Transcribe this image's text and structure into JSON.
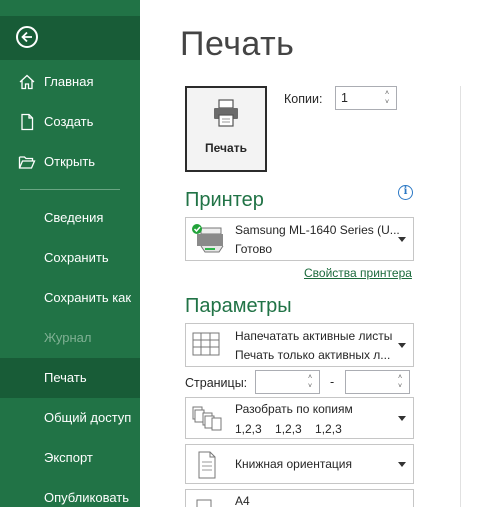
{
  "sidebar": {
    "back_icon": "back-arrow-icon",
    "items": [
      {
        "label": "Главная",
        "icon": "home-icon"
      },
      {
        "label": "Создать",
        "icon": "new-document-icon"
      },
      {
        "label": "Открыть",
        "icon": "open-folder-icon"
      },
      {
        "label": "Сведения"
      },
      {
        "label": "Сохранить"
      },
      {
        "label": "Сохранить как"
      },
      {
        "label": "Журнал",
        "disabled": true
      },
      {
        "label": "Печать",
        "selected": true
      },
      {
        "label": "Общий доступ"
      },
      {
        "label": "Экспорт"
      },
      {
        "label": "Опубликовать"
      }
    ]
  },
  "main": {
    "title": "Печать",
    "print_button_label": "Печать",
    "copies_label": "Копии:",
    "copies_value": "1",
    "printer_section": "Принтер",
    "printer": {
      "name": "Samsung ML-1640 Series (U...",
      "status": "Готово",
      "properties_link": "Свойства принтера"
    },
    "settings_section": "Параметры",
    "settings": {
      "scope_title": "Напечатать активные листы",
      "scope_desc": "Печать только активных л...",
      "pages_label": "Страницы:",
      "pages_dash": "-",
      "collate_title": "Разобрать по копиям",
      "collate_desc": "1,2,3    1,2,3    1,2,3",
      "orientation": "Книжная ориентация",
      "paper": "A4"
    }
  },
  "colors": {
    "sidebar": "#217346",
    "sidebar_selected": "#185c37",
    "accent": "#217346"
  }
}
